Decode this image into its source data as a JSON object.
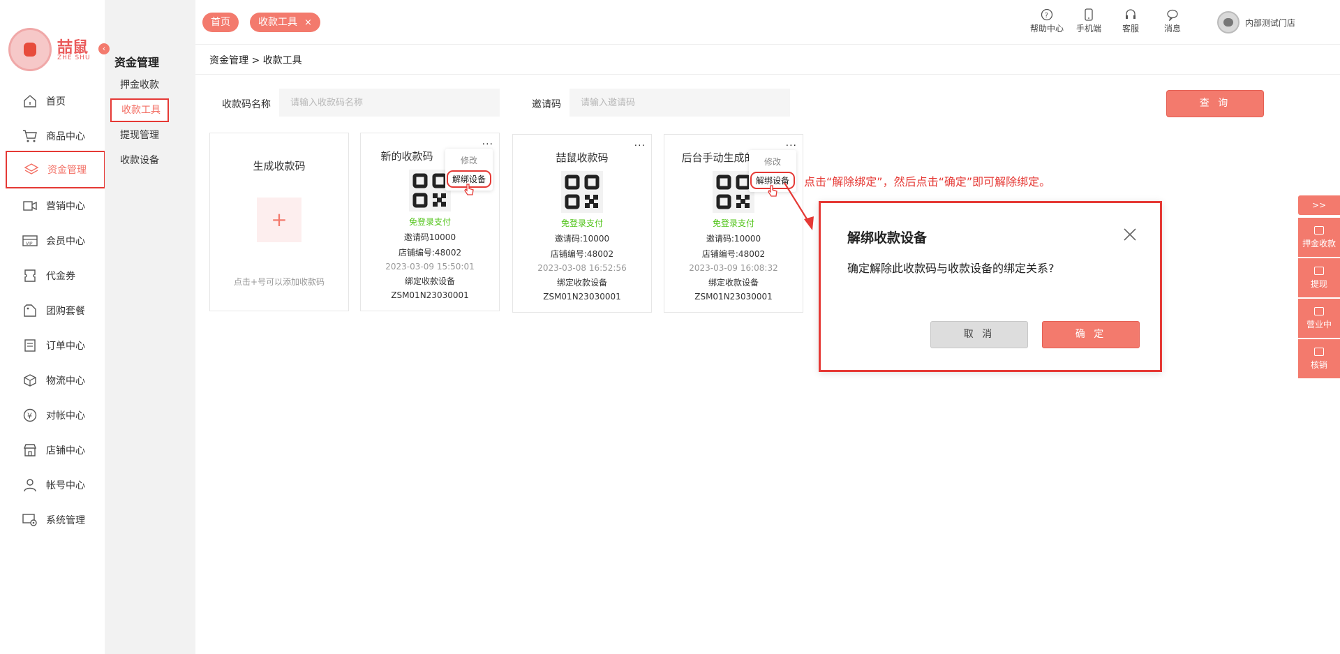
{
  "logo": {
    "text": "喆鼠",
    "sub": "ZHE SHU"
  },
  "nav": {
    "items": [
      {
        "label": "首页",
        "icon": "home-icon"
      },
      {
        "label": "商品中心",
        "icon": "cart-icon"
      },
      {
        "label": "资金管理",
        "icon": "layers-icon"
      },
      {
        "label": "营销中心",
        "icon": "marketing-icon"
      },
      {
        "label": "会员中心",
        "icon": "vip-card-icon"
      },
      {
        "label": "代金券",
        "icon": "coupon-icon"
      },
      {
        "label": "团购套餐",
        "icon": "tag-icon"
      },
      {
        "label": "订单中心",
        "icon": "order-icon"
      },
      {
        "label": "物流中心",
        "icon": "box-icon"
      },
      {
        "label": "对帐中心",
        "icon": "yen-icon"
      },
      {
        "label": "店铺中心",
        "icon": "store-icon"
      },
      {
        "label": "帐号中心",
        "icon": "user-icon"
      },
      {
        "label": "系统管理",
        "icon": "settings-icon"
      }
    ]
  },
  "submenu": {
    "title": "资金管理",
    "items": [
      {
        "label": "押金收款"
      },
      {
        "label": "收款工具"
      },
      {
        "label": "提现管理"
      },
      {
        "label": "收款设备"
      }
    ]
  },
  "tabs": [
    {
      "label": "首页"
    },
    {
      "label": "收款工具",
      "close": "×"
    }
  ],
  "topbar": {
    "help": "帮助中心",
    "mobile": "手机端",
    "service": "客服",
    "messages": "消息",
    "user": "内部测试门店"
  },
  "breadcrumb": "资金管理  > 收款工具",
  "search": {
    "code_name_label": "收款码名称",
    "code_name_placeholder": "请输入收款码名称",
    "invite_label": "邀请码",
    "invite_placeholder": "请输入邀请码",
    "query_button": "查 询"
  },
  "add_card": {
    "title": "生成收款码",
    "plus": "+",
    "hint": "点击+号可以添加收款码"
  },
  "cards": [
    {
      "title": "新的收款码",
      "free": "免登录支付",
      "invite": "邀请码10000",
      "store": "店铺编号:48002",
      "time": "2023-03-09 15:50:01",
      "bind_label": "绑定收款设备",
      "device": "ZSM01N23030001",
      "menu": {
        "more": "...",
        "edit": "修改",
        "unbind": "解绑设备"
      }
    },
    {
      "title": "喆鼠收款码",
      "free": "免登录支付",
      "invite": "邀请码:10000",
      "store": "店铺编号:48002",
      "time": "2023-03-08 16:52:56",
      "bind_label": "绑定收款设备",
      "device": "ZSM01N23030001",
      "menu": {
        "more": "..."
      }
    },
    {
      "title": "后台手动生成的",
      "free": "免登录支付",
      "invite": "邀请码:10000",
      "store": "店铺编号:48002",
      "time": "2023-03-09 16:08:32",
      "bind_label": "绑定收款设备",
      "device": "ZSM01N23030001",
      "menu": {
        "more": "...",
        "edit": "修改",
        "unbind": "解绑设备"
      }
    }
  ],
  "annotation": "点击“解除绑定”，然后点击“确定”即可解除绑定。",
  "modal": {
    "title": "解绑收款设备",
    "body": "确定解除此收款码与收款设备的绑定关系?",
    "cancel": "取 消",
    "ok": "确 定"
  },
  "float_bar": {
    "expand": ">>",
    "items": [
      {
        "label": "押金收款"
      },
      {
        "label": "提现"
      },
      {
        "label": "营业中"
      },
      {
        "label": "核销"
      }
    ]
  },
  "colors": {
    "accent": "#f37a6d",
    "highlight": "#e53935",
    "green": "#52c41a"
  }
}
